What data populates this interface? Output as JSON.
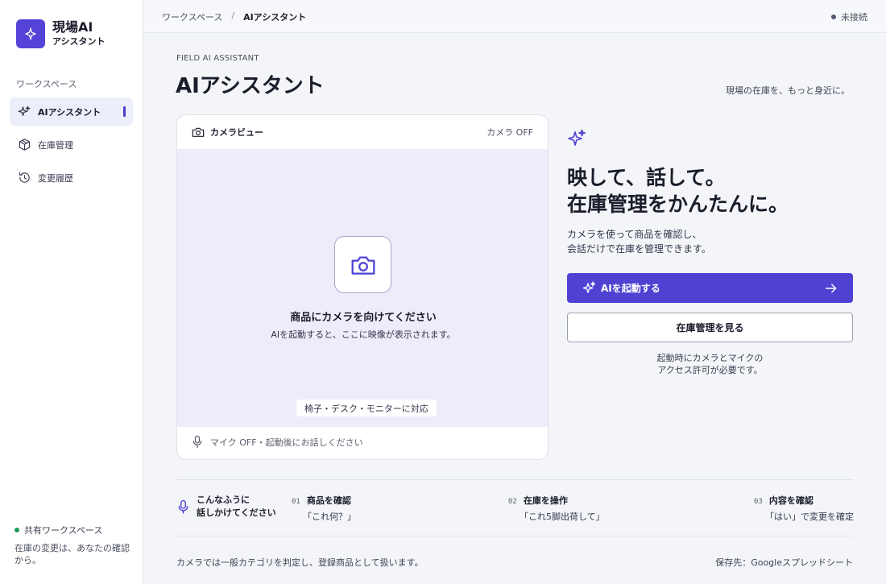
{
  "brand": {
    "name": "現場AI",
    "sub": "アシスタント",
    "icon": "sparkle-icon",
    "color": "#5443d6"
  },
  "sidebar": {
    "section_label": "ワークスペース",
    "items": [
      {
        "label": "AIアシスタント",
        "icon": "sparkle-icon",
        "active": true
      },
      {
        "label": "在庫管理",
        "icon": "box-icon",
        "active": false
      },
      {
        "label": "変更履歴",
        "icon": "history-icon",
        "active": false
      }
    ],
    "footer": {
      "workspace": "共有ワークスペース",
      "note": "在庫の変更は、あなたの確認から。",
      "status_color": "#1b9a55"
    }
  },
  "header": {
    "breadcrumb": [
      "ワークスペース",
      "AIアシスタント"
    ],
    "separator": "/",
    "status": "未接続"
  },
  "main": {
    "eyebrow": "FIELD AI ASSISTANT",
    "title": "AIアシスタント",
    "tagline": "現場の在庫を、もっと身近に。"
  },
  "camera": {
    "title": "カメラビュー",
    "state": "カメラ OFF",
    "prompt": "商品にカメラを向けてください",
    "hint": "AIを起動すると、ここに映像が表示されます。",
    "support": "椅子・デスク・モニターに対応",
    "mic": "マイク OFF・起動後にお話しください"
  },
  "panel": {
    "headline_1": "映して、話して。",
    "headline_2": "在庫管理をかんたんに。",
    "desc_1": "カメラを使って商品を確認し、",
    "desc_2": "会話だけで在庫を管理できます。",
    "primary": "AIを起動する",
    "secondary": "在庫管理を見る",
    "note_1": "起動時にカメラとマイクの",
    "note_2": "アクセス許可が必要です。",
    "accent": "#4f42d2"
  },
  "examples": {
    "lead_1": "こんなふうに",
    "lead_2": "話しかけてください",
    "items": [
      {
        "num": "01",
        "title": "商品を確認",
        "quote": "「これ何？」"
      },
      {
        "num": "02",
        "title": "在庫を操作",
        "quote": "「これ5脚出荷して」"
      },
      {
        "num": "03",
        "title": "内容を確認",
        "quote": "「はい」で変更を確定"
      }
    ]
  },
  "footer": {
    "left": "カメラでは一般カテゴリを判定し、登録商品として扱います。",
    "right": "保存先：Googleスプレッドシート"
  }
}
